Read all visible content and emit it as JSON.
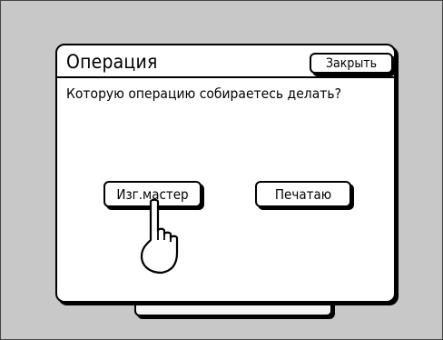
{
  "dialog": {
    "title": "Операция",
    "close_label": "Закрыть",
    "prompt": "Которую операцию собираетесь делать?",
    "options": [
      {
        "label": "Изг.мастер"
      },
      {
        "label": "Печатаю"
      }
    ]
  },
  "pointer": {
    "icon": "pointing-hand-icon",
    "target": "Изг.мастер"
  }
}
